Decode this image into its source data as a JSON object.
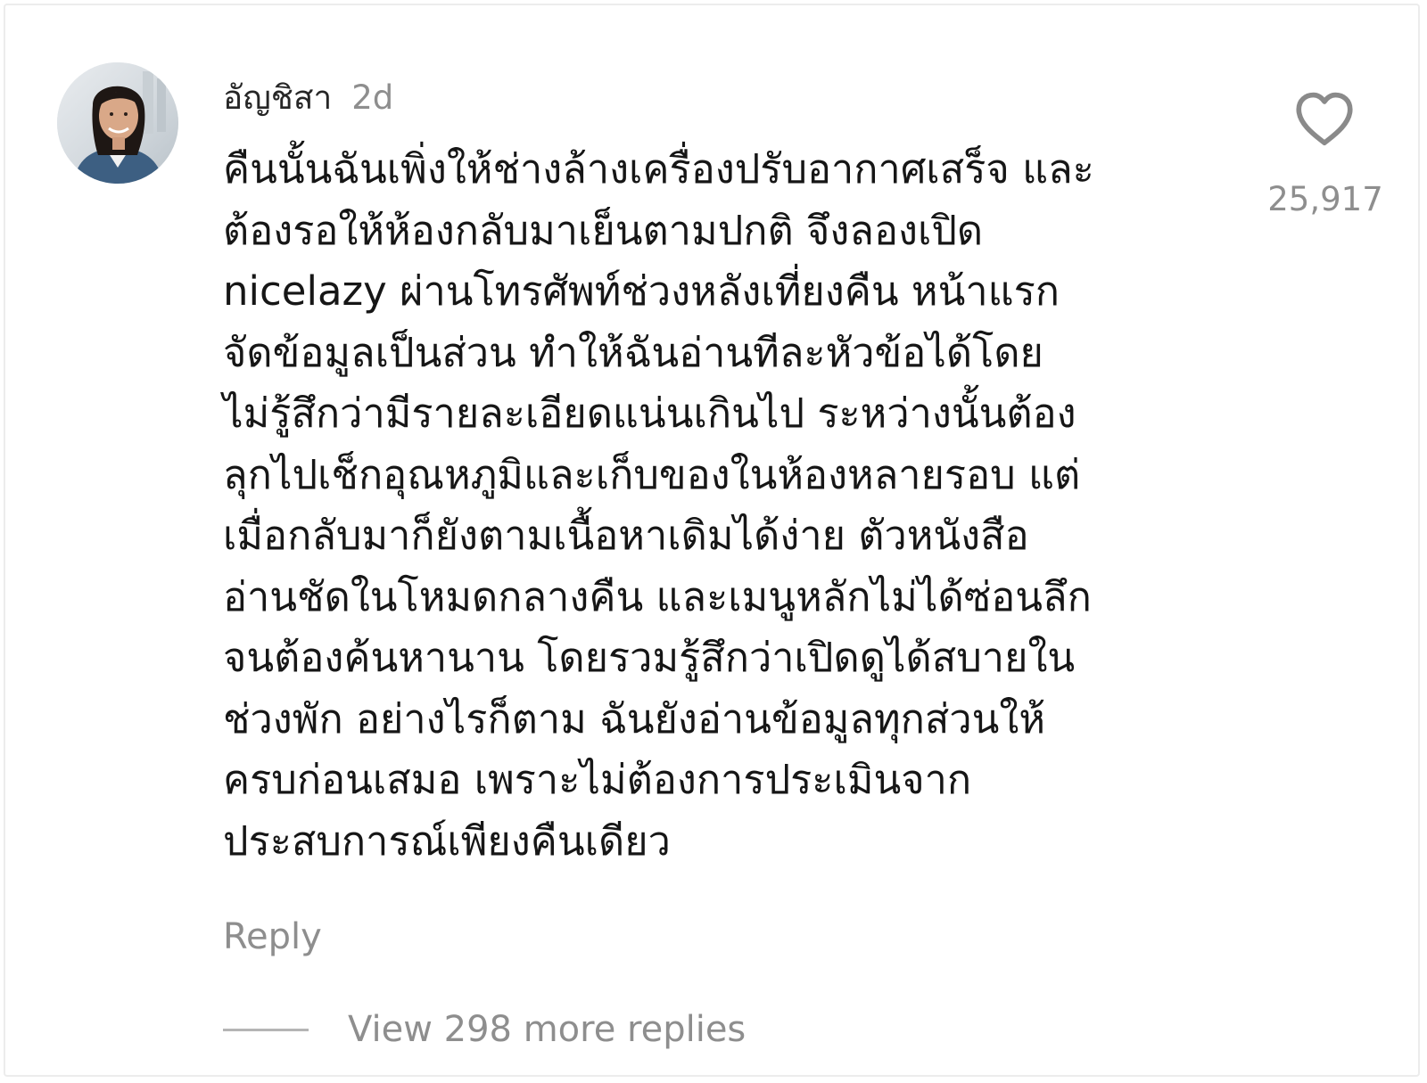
{
  "comment": {
    "username": "อัญชิสา",
    "timestamp": "2d",
    "avatar_icon": "user-avatar-photo",
    "text_lines": [
      "คืนนั้นฉันเพิ่งให้ช่างล้างเครื่องปรับอากาศเสร็จ และ",
      "ต้องรอให้ห้องกลับมาเย็นตามปกติ จึงลองเปิด",
      "nicelazy ผ่านโทรศัพท์ช่วงหลังเที่ยงคืน หน้าแรก",
      "จัดข้อมูลเป็นส่วน ทำให้ฉันอ่านทีละหัวข้อได้โดย",
      "ไม่รู้สึกว่ามีรายละเอียดแน่นเกินไป ระหว่างนั้นต้อง",
      "ลุกไปเช็กอุณหภูมิและเก็บของในห้องหลายรอบ แต่",
      "เมื่อกลับมาก็ยังตามเนื้อหาเดิมได้ง่าย ตัวหนังสือ",
      "อ่านชัดในโหมดกลางคืน และเมนูหลักไม่ได้ซ่อนลึก",
      "จนต้องค้นหานาน โดยรวมรู้สึกว่าเปิดดูได้สบายใน",
      "ช่วงพัก อย่างไรก็ตาม ฉันยังอ่านข้อมูลทุกส่วนให้",
      "ครบก่อนเสมอ เพราะไม่ต้องการประเมินจาก",
      "ประสบการณ์เพียงคืนเดียว"
    ],
    "like_icon": "heart-outline-icon",
    "like_count": "25,917",
    "reply_label": "Reply",
    "view_replies_label": "View 298 more replies"
  },
  "colors": {
    "primary_text": "#161616",
    "secondary_text": "#8e8e8e",
    "divider": "#b5b5b5",
    "background": "#ffffff"
  }
}
